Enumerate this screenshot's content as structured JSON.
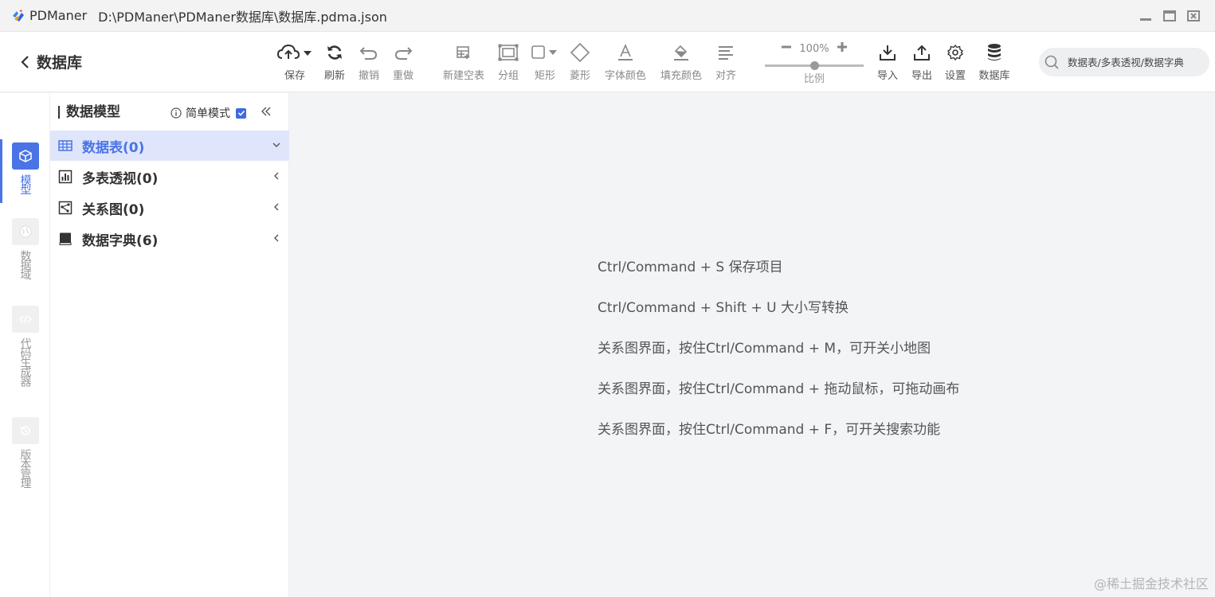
{
  "window": {
    "app_name": "PDManer",
    "file_path": "D:\\PDManer\\PDManer数据库\\数据库.pdma.json"
  },
  "header": {
    "back_label": "数据库"
  },
  "toolbar": {
    "save": "保存",
    "refresh": "刷新",
    "undo": "撤销",
    "redo": "重做",
    "new_table": "新建空表",
    "group": "分组",
    "rect": "矩形",
    "diamond": "菱形",
    "font_color": "字体颜色",
    "fill_color": "填充颜色",
    "align": "对齐",
    "zoom_value": "100%",
    "zoom_label": "比例",
    "zoom_level_percent": 100,
    "import": "导入",
    "export": "导出",
    "settings": "设置",
    "database": "数据库"
  },
  "search": {
    "placeholder": "数据表/多表透视/数据字典"
  },
  "rail": {
    "items": [
      {
        "label": "模型",
        "active": true
      },
      {
        "label": "数据域",
        "active": false
      },
      {
        "label": "代码生成器",
        "active": false
      },
      {
        "label": "版本管理",
        "active": false
      }
    ]
  },
  "panel": {
    "title": "数据模型",
    "simple_mode": "简单模式",
    "simple_mode_checked": true,
    "tree": [
      {
        "label": "数据表(0)",
        "active": true,
        "expanded": true
      },
      {
        "label": "多表透视(0)",
        "active": false,
        "expanded": false
      },
      {
        "label": "关系图(0)",
        "active": false,
        "expanded": false
      },
      {
        "label": "数据字典(6)",
        "active": false,
        "expanded": false
      }
    ]
  },
  "main": {
    "tips": [
      "Ctrl/Command + S 保存项目",
      "Ctrl/Command + Shift + U 大小写转换",
      "关系图界面，按住Ctrl/Command + M，可开关小地图",
      "关系图界面，按住Ctrl/Command + 拖动鼠标，可拖动画布",
      "关系图界面，按住Ctrl/Command + F，可开关搜索功能"
    ],
    "watermark": "@稀土掘金技术社区"
  },
  "colors": {
    "accent": "#4a74e6",
    "active_row_bg": "#dfe6fb"
  }
}
